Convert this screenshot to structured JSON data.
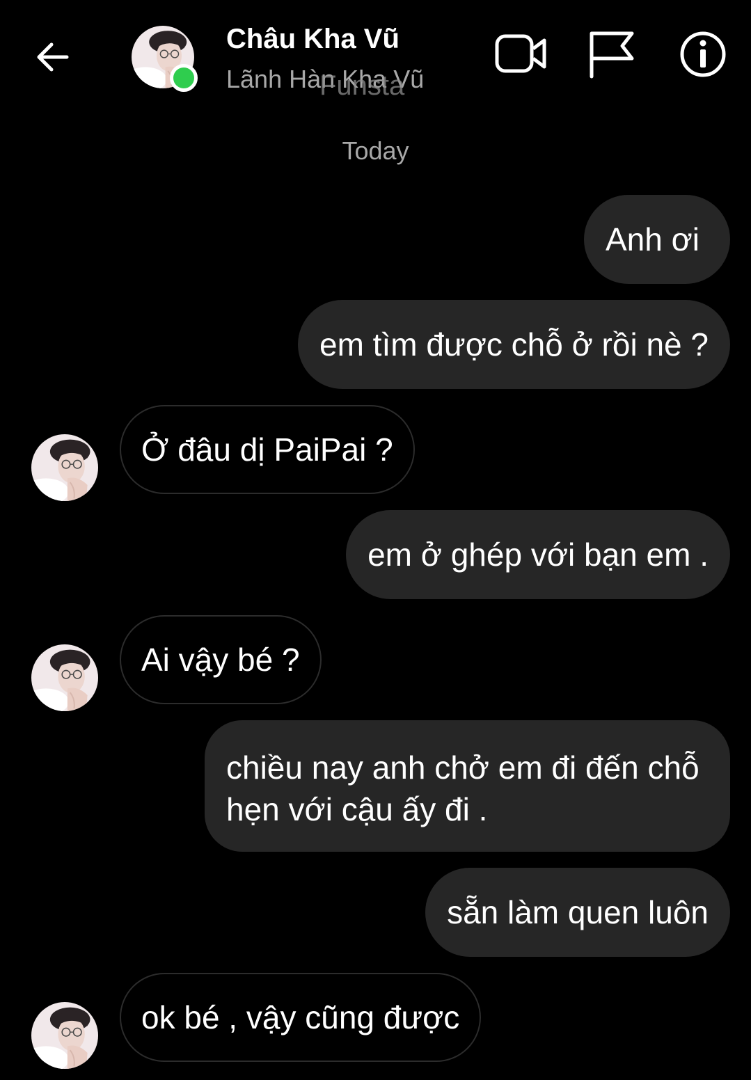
{
  "header": {
    "contact_name": "Châu Kha Vũ",
    "contact_username": "Lãnh Hàn Kha Vũ",
    "overlay_text": "Funsta",
    "status_color": "#2fcd4e",
    "icons": [
      "back-arrow-icon",
      "video-call-icon",
      "flag-icon",
      "info-icon"
    ]
  },
  "conversation": {
    "day_label": "Today",
    "messages": [
      {
        "direction": "sent",
        "text": "Anh ơi"
      },
      {
        "direction": "sent",
        "text": "em tìm được chỗ ở rồi nè ?"
      },
      {
        "direction": "received",
        "text": "Ở đâu dị PaiPai ?"
      },
      {
        "direction": "sent",
        "text": "em ở ghép với bạn em ."
      },
      {
        "direction": "received",
        "text": "Ai vậy bé ?"
      },
      {
        "direction": "sent",
        "text": "chiều nay anh chở em đi đến chỗ hẹn với cậu ấy đi ."
      },
      {
        "direction": "sent",
        "text": "sẵn làm quen luôn"
      },
      {
        "direction": "received",
        "text": "ok bé , vậy cũng được"
      }
    ]
  },
  "colors": {
    "background": "#000000",
    "sent_bubble": "#262626",
    "received_border": "#2c2c2c",
    "secondary_text": "#a8a8a8"
  }
}
